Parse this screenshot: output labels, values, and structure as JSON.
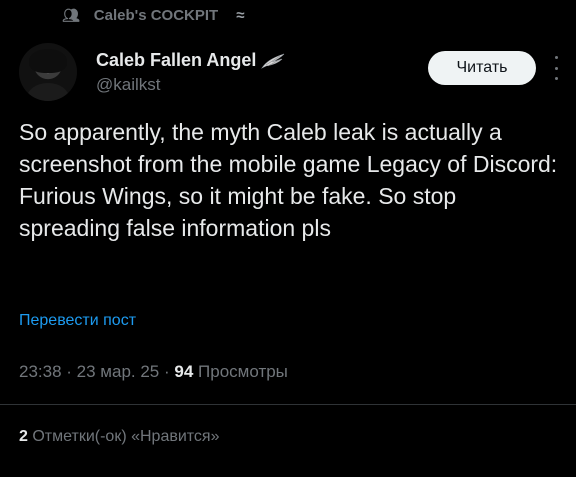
{
  "community": {
    "icon": "people-icon",
    "name": "Caleb's COCKPIT",
    "badge_icon": "wing-icon"
  },
  "author": {
    "display_name": "Caleb Fallen Angel",
    "name_badge_icon": "angel-wing-icon",
    "handle": "@kailkst",
    "avatar_icon": "avatar-photo"
  },
  "follow_button": {
    "label": "Читать"
  },
  "more_icon": "more-vertical-icon",
  "tweet": {
    "text": "So apparently, the myth Caleb leak is actually a screenshot from the mobile game Legacy of Discord: Furious Wings, so it might be fake. So stop spreading false information pls",
    "translate_label": "Перевести пост"
  },
  "meta": {
    "time": "23:38",
    "date": "23 мар. 25",
    "views_count": "94",
    "views_label": "Просмотры"
  },
  "likes": {
    "count": "2",
    "label": "Отметки(-ок) «Нравится»"
  },
  "colors": {
    "background": "#000000",
    "text": "#e7e9ea",
    "secondary": "#71767b",
    "link": "#1d9bf0",
    "button_bg": "#eff3f4"
  }
}
